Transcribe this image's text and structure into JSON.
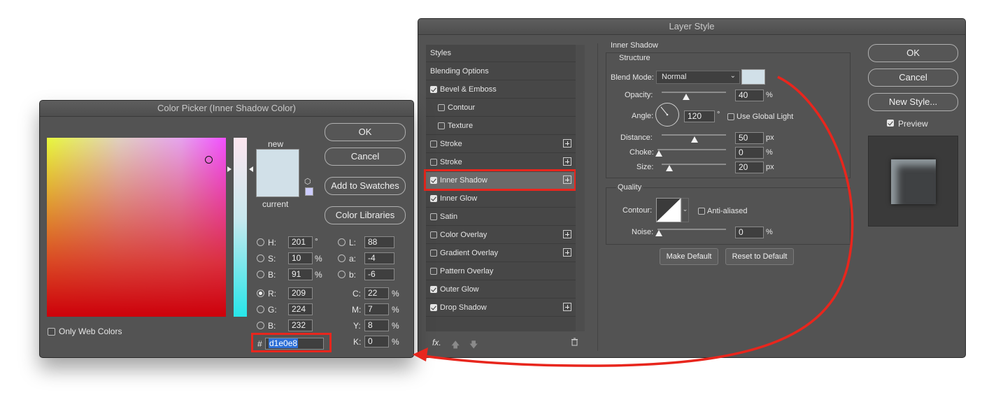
{
  "color_picker": {
    "title": "Color Picker (Inner Shadow Color)",
    "buttons": {
      "ok": "OK",
      "cancel": "Cancel",
      "add_swatches": "Add to Swatches",
      "libraries": "Color Libraries"
    },
    "swatch_labels": {
      "new": "new",
      "current": "current"
    },
    "only_web_colors": "Only Web Colors",
    "hsb": {
      "h_label": "H:",
      "h": "201",
      "h_unit": "°",
      "s_label": "S:",
      "s": "10",
      "s_unit": "%",
      "b_label": "B:",
      "b": "91",
      "b_unit": "%"
    },
    "lab": {
      "l_label": "L:",
      "l": "88",
      "a_label": "a:",
      "a": "-4",
      "b_label": "b:",
      "b": "-6"
    },
    "rgb": {
      "r_label": "R:",
      "r": "209",
      "g_label": "G:",
      "g": "224",
      "b_label": "B:",
      "b": "232"
    },
    "cmyk": {
      "c_label": "C:",
      "c": "22",
      "m_label": "M:",
      "m": "7",
      "y_label": "Y:",
      "y": "8",
      "k_label": "K:",
      "k": "0",
      "unit": "%"
    },
    "hex_label": "#",
    "hex": "d1e0e8",
    "color": "#d1e0e8"
  },
  "layer_style": {
    "title": "Layer Style",
    "styles_list": [
      {
        "label": "Styles",
        "checkbox": false,
        "checked": false,
        "plus": false
      },
      {
        "label": "Blending Options",
        "checkbox": false,
        "checked": false,
        "plus": false
      },
      {
        "label": "Bevel & Emboss",
        "checkbox": true,
        "checked": true,
        "plus": false
      },
      {
        "label": "Contour",
        "checkbox": true,
        "checked": false,
        "plus": false
      },
      {
        "label": "Texture",
        "checkbox": true,
        "checked": false,
        "plus": false
      },
      {
        "label": "Stroke",
        "checkbox": true,
        "checked": false,
        "plus": true
      },
      {
        "label": "Stroke",
        "checkbox": true,
        "checked": false,
        "plus": true
      },
      {
        "label": "Inner Shadow",
        "checkbox": true,
        "checked": true,
        "plus": true
      },
      {
        "label": "Inner Glow",
        "checkbox": true,
        "checked": true,
        "plus": false
      },
      {
        "label": "Satin",
        "checkbox": true,
        "checked": false,
        "plus": false
      },
      {
        "label": "Color Overlay",
        "checkbox": true,
        "checked": false,
        "plus": true
      },
      {
        "label": "Gradient Overlay",
        "checkbox": true,
        "checked": false,
        "plus": true
      },
      {
        "label": "Pattern Overlay",
        "checkbox": true,
        "checked": false,
        "plus": false
      },
      {
        "label": "Outer Glow",
        "checkbox": true,
        "checked": true,
        "plus": false
      },
      {
        "label": "Drop Shadow",
        "checkbox": true,
        "checked": true,
        "plus": true
      }
    ],
    "fx_label": "fx.",
    "inner_shadow": {
      "section": "Inner Shadow",
      "structure": "Structure",
      "blend_mode_label": "Blend Mode:",
      "blend_mode": "Normal",
      "opacity_label": "Opacity:",
      "opacity": "40",
      "opacity_unit": "%",
      "angle_label": "Angle:",
      "angle": "120",
      "angle_unit": "°",
      "use_global_light": "Use Global Light",
      "distance_label": "Distance:",
      "distance": "50",
      "distance_unit": "px",
      "choke_label": "Choke:",
      "choke": "0",
      "choke_unit": "%",
      "size_label": "Size:",
      "size": "20",
      "size_unit": "px",
      "quality": "Quality",
      "contour_label": "Contour:",
      "anti_aliased": "Anti-aliased",
      "noise_label": "Noise:",
      "noise": "0",
      "noise_unit": "%",
      "make_default": "Make Default",
      "reset_default": "Reset to Default"
    },
    "buttons": {
      "ok": "OK",
      "cancel": "Cancel",
      "new_style": "New Style..."
    },
    "preview_label": "Preview"
  },
  "annotation_color": "#e8261d"
}
